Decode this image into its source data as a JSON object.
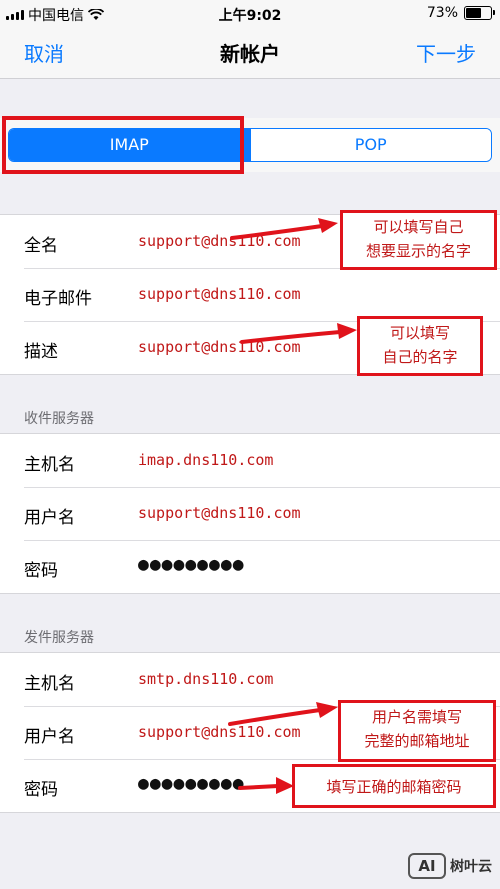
{
  "status_bar": {
    "carrier": "中国电信",
    "time": "上午9:02",
    "battery": "73%",
    "battery_level": 0.73
  },
  "nav": {
    "cancel": "取消",
    "title": "新帐户",
    "next": "下一步"
  },
  "segment": {
    "imap": "IMAP",
    "pop": "POP",
    "selected": "IMAP"
  },
  "account": {
    "fullname_label": "全名",
    "fullname_value": "support@dns110.com",
    "email_label": "电子邮件",
    "email_value": "support@dns110.com",
    "desc_label": "描述",
    "desc_value": "support@dns110.com"
  },
  "incoming": {
    "header": "收件服务器",
    "host_label": "主机名",
    "host_value": "imap.dns110.com",
    "user_label": "用户名",
    "user_value": "support@dns110.com",
    "pass_label": "密码",
    "pass_value": "●●●●●●●●●"
  },
  "outgoing": {
    "header": "发件服务器",
    "host_label": "主机名",
    "host_value": "smtp.dns110.com",
    "user_label": "用户名",
    "user_value": "support@dns110.com",
    "pass_label": "密码",
    "pass_value": "●●●●●●●●●"
  },
  "annotations": {
    "fullname_line1": "可以填写自己",
    "fullname_line2": "想要显示的名字",
    "desc_line1": "可以填写",
    "desc_line2": "自己的名字",
    "user_line1": "用户名需填写",
    "user_line2": "完整的邮箱地址",
    "pass_line1": "填写正确的邮箱密码"
  },
  "watermark": {
    "logo": "AI",
    "text": "树叶云"
  },
  "colors": {
    "accent": "#0a7aff",
    "annotation_red": "#e0131b"
  }
}
